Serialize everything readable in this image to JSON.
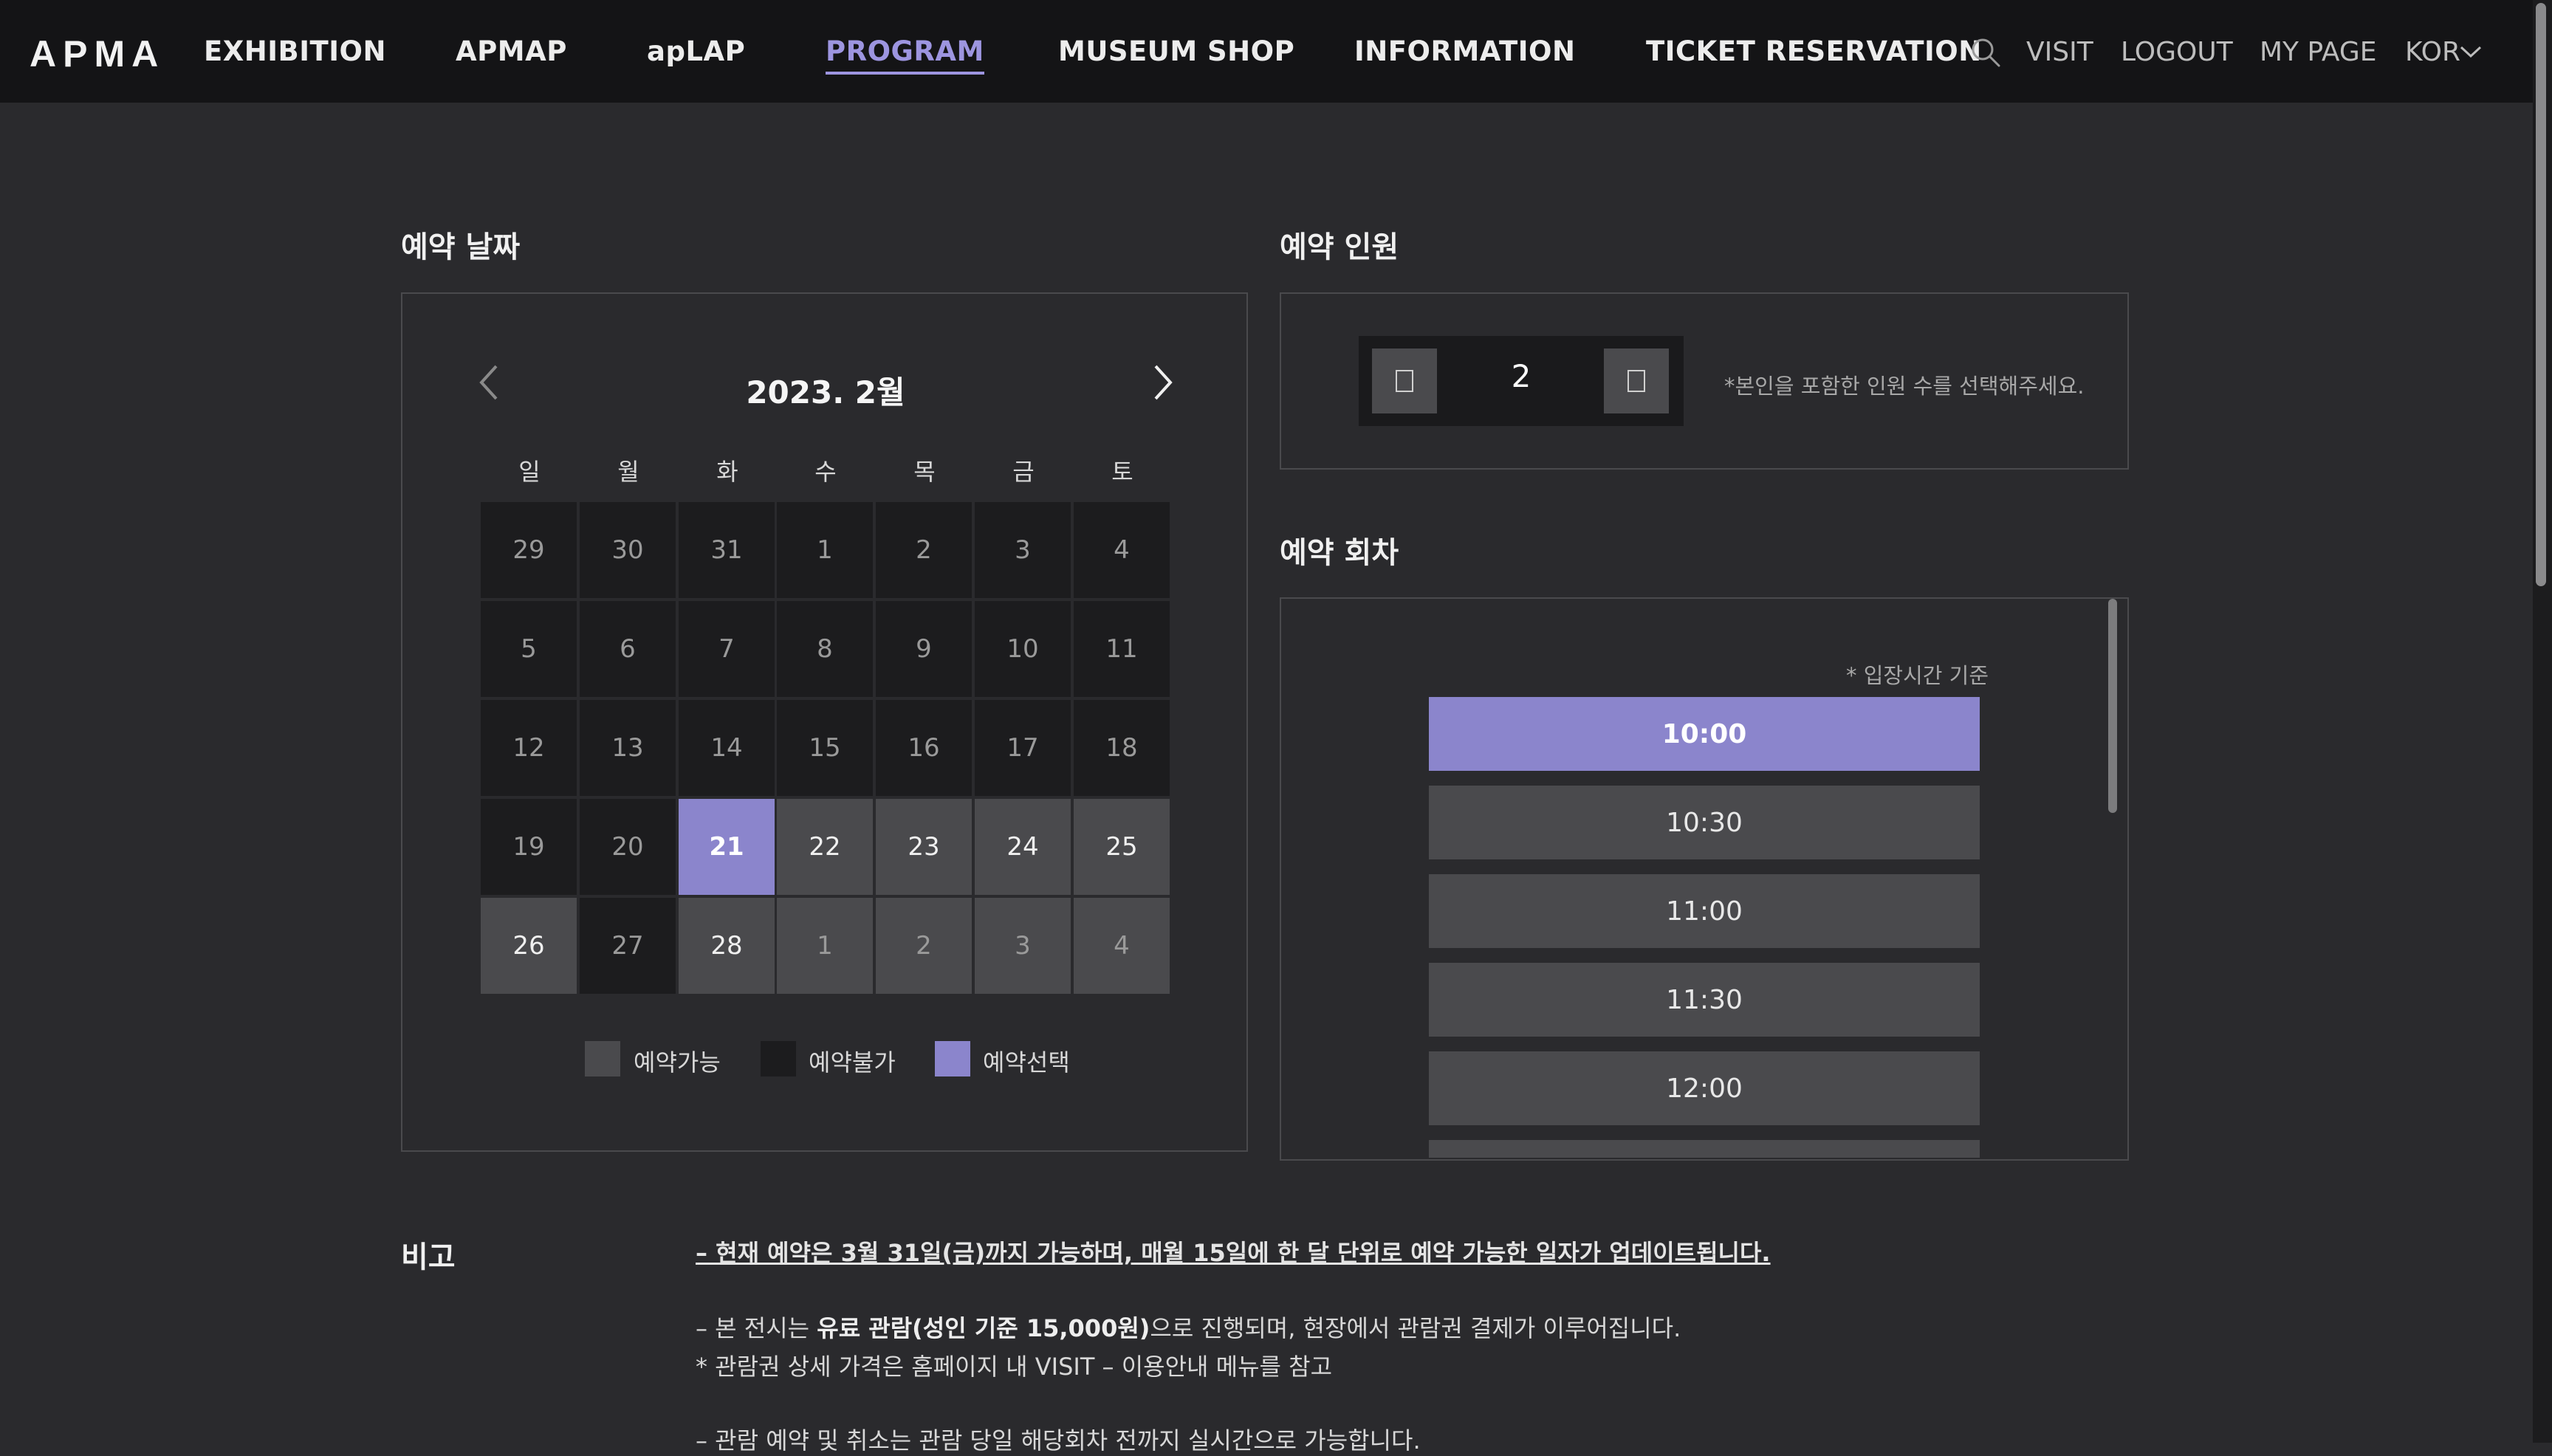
{
  "header": {
    "logo": "APMA",
    "nav": [
      {
        "label": "EXHIBITION",
        "active": false
      },
      {
        "label": "APMAP",
        "active": false
      },
      {
        "label": "apLAP",
        "active": false
      },
      {
        "label": "PROGRAM",
        "active": true
      },
      {
        "label": "MUSEUM SHOP",
        "active": false
      },
      {
        "label": "INFORMATION",
        "active": false
      },
      {
        "label": "TICKET RESERVATION",
        "active": false
      }
    ],
    "utils": {
      "visit": "VISIT",
      "logout": "LOGOUT",
      "my_page": "MY PAGE",
      "language": "KOR"
    },
    "search_icon": "search-icon"
  },
  "date_section": {
    "title": "예약 날짜",
    "month_label": "2023. 2월",
    "weekdays": [
      "일",
      "월",
      "화",
      "수",
      "목",
      "금",
      "토"
    ],
    "weeks": [
      [
        {
          "d": "29",
          "s": "unavail"
        },
        {
          "d": "30",
          "s": "unavail"
        },
        {
          "d": "31",
          "s": "unavail"
        },
        {
          "d": "1",
          "s": "unavail"
        },
        {
          "d": "2",
          "s": "unavail"
        },
        {
          "d": "3",
          "s": "unavail"
        },
        {
          "d": "4",
          "s": "unavail"
        }
      ],
      [
        {
          "d": "5",
          "s": "unavail"
        },
        {
          "d": "6",
          "s": "unavail"
        },
        {
          "d": "7",
          "s": "unavail"
        },
        {
          "d": "8",
          "s": "unavail"
        },
        {
          "d": "9",
          "s": "unavail"
        },
        {
          "d": "10",
          "s": "unavail"
        },
        {
          "d": "11",
          "s": "unavail"
        }
      ],
      [
        {
          "d": "12",
          "s": "unavail"
        },
        {
          "d": "13",
          "s": "unavail"
        },
        {
          "d": "14",
          "s": "unavail"
        },
        {
          "d": "15",
          "s": "unavail"
        },
        {
          "d": "16",
          "s": "unavail"
        },
        {
          "d": "17",
          "s": "unavail"
        },
        {
          "d": "18",
          "s": "unavail"
        }
      ],
      [
        {
          "d": "19",
          "s": "unavail"
        },
        {
          "d": "20",
          "s": "unavail"
        },
        {
          "d": "21",
          "s": "selected"
        },
        {
          "d": "22",
          "s": "avail"
        },
        {
          "d": "23",
          "s": "avail"
        },
        {
          "d": "24",
          "s": "avail"
        },
        {
          "d": "25",
          "s": "avail"
        }
      ],
      [
        {
          "d": "26",
          "s": "avail"
        },
        {
          "d": "27",
          "s": "unavail"
        },
        {
          "d": "28",
          "s": "avail"
        },
        {
          "d": "1",
          "s": "avail-dim"
        },
        {
          "d": "2",
          "s": "avail-dim"
        },
        {
          "d": "3",
          "s": "avail-dim"
        },
        {
          "d": "4",
          "s": "avail-dim"
        }
      ]
    ],
    "legend": [
      {
        "label": "예약가능",
        "color": "#4a4a4d"
      },
      {
        "label": "예약불가",
        "color": "#1c1c1e"
      },
      {
        "label": "예약선택",
        "color": "#8b85cc"
      }
    ]
  },
  "people_section": {
    "title": "예약 인원",
    "count": "2",
    "note": "*본인을 포함한 인원 수를 선택해주세요."
  },
  "session_section": {
    "title": "예약 회차",
    "note": "* 입장시간 기준",
    "slots": [
      {
        "time": "10:00",
        "selected": true
      },
      {
        "time": "10:30",
        "selected": false
      },
      {
        "time": "11:00",
        "selected": false
      },
      {
        "time": "11:30",
        "selected": false
      },
      {
        "time": "12:00",
        "selected": false
      },
      {
        "time": "",
        "selected": false
      }
    ]
  },
  "notes": {
    "title": "비고",
    "line1": "– 현재 예약은 3월 31일(금)까지 가능하며, 매월 15일에 한 달 단위로 예약 가능한 일자가 업데이트됩니다.",
    "line2_pre": "– 본 전시는 ",
    "line2_bold": "유료 관람(성인 기준 15,000원)",
    "line2_post": "으로 진행되며, 현장에서 관람권 결제가 이루어집니다.",
    "line3": "* 관람권 상세 가격은 홈페이지 내 VISIT – 이용안내 메뉴를 참고",
    "line4": "– 관람 예약 및 취소는 관람 당일 해당회차 전까지 실시간으로 가능합니다."
  },
  "colors": {
    "accent": "#8b85cc",
    "nav_active": "#9d95e0",
    "available": "#4a4a4d",
    "unavailable": "#1c1c1e"
  }
}
